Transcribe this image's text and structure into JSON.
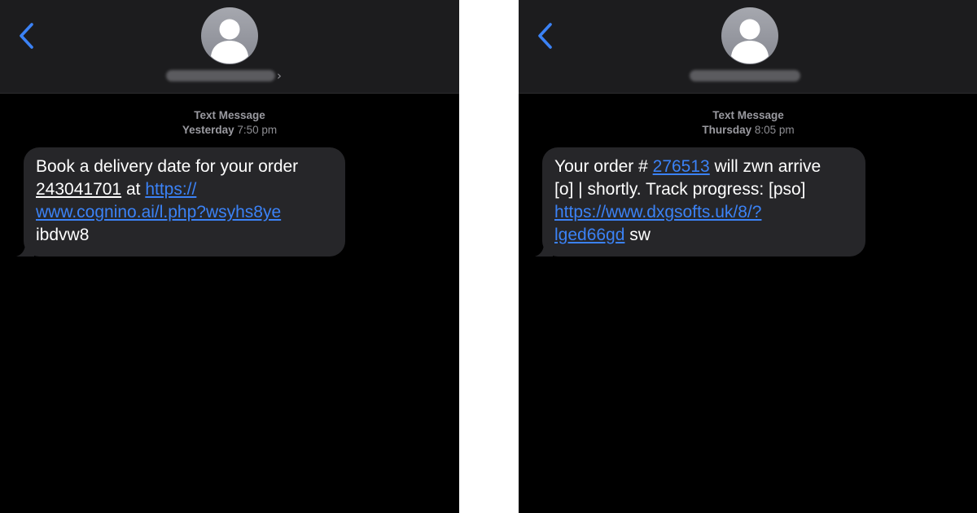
{
  "theme": {
    "background": "#000000",
    "header_background": "#1c1c1e",
    "bubble_background": "#262629",
    "accent": "#3b82f6",
    "meta_text": "#8e8e93",
    "divider": "#ffffff"
  },
  "icons": {
    "back": "chevron-left-icon",
    "avatar": "person-silhouette-icon",
    "disclosure": "chevron-right-icon"
  },
  "left": {
    "header": {
      "contact_name_redacted": true,
      "disclosure_glyph": "›"
    },
    "thread": {
      "service": "Text Message",
      "timestamp_day": "Yesterday",
      "timestamp_time": "7:50 pm"
    },
    "message": {
      "line1": "Book a delivery date for your order",
      "order_number": "243041701",
      "at_text": " at ",
      "link_part1": "https://",
      "link_part2": "www.cognino.ai/l.php?wsyhs8ye",
      "line4": "ibdvw8"
    }
  },
  "right": {
    "header": {
      "contact_name_redacted": true
    },
    "thread": {
      "service": "Text Message",
      "timestamp_day": "Thursday",
      "timestamp_time": "8:05 pm"
    },
    "message": {
      "prefix": "Your order # ",
      "order_number": "276513",
      "after_number": " will zwn arrive",
      "line2": "[o] | shortly. Track progress: [pso]",
      "link_part1": "https://www.dxgsofts.uk/8/?",
      "link_part2": "lged66gd",
      "suffix": " sw"
    }
  }
}
